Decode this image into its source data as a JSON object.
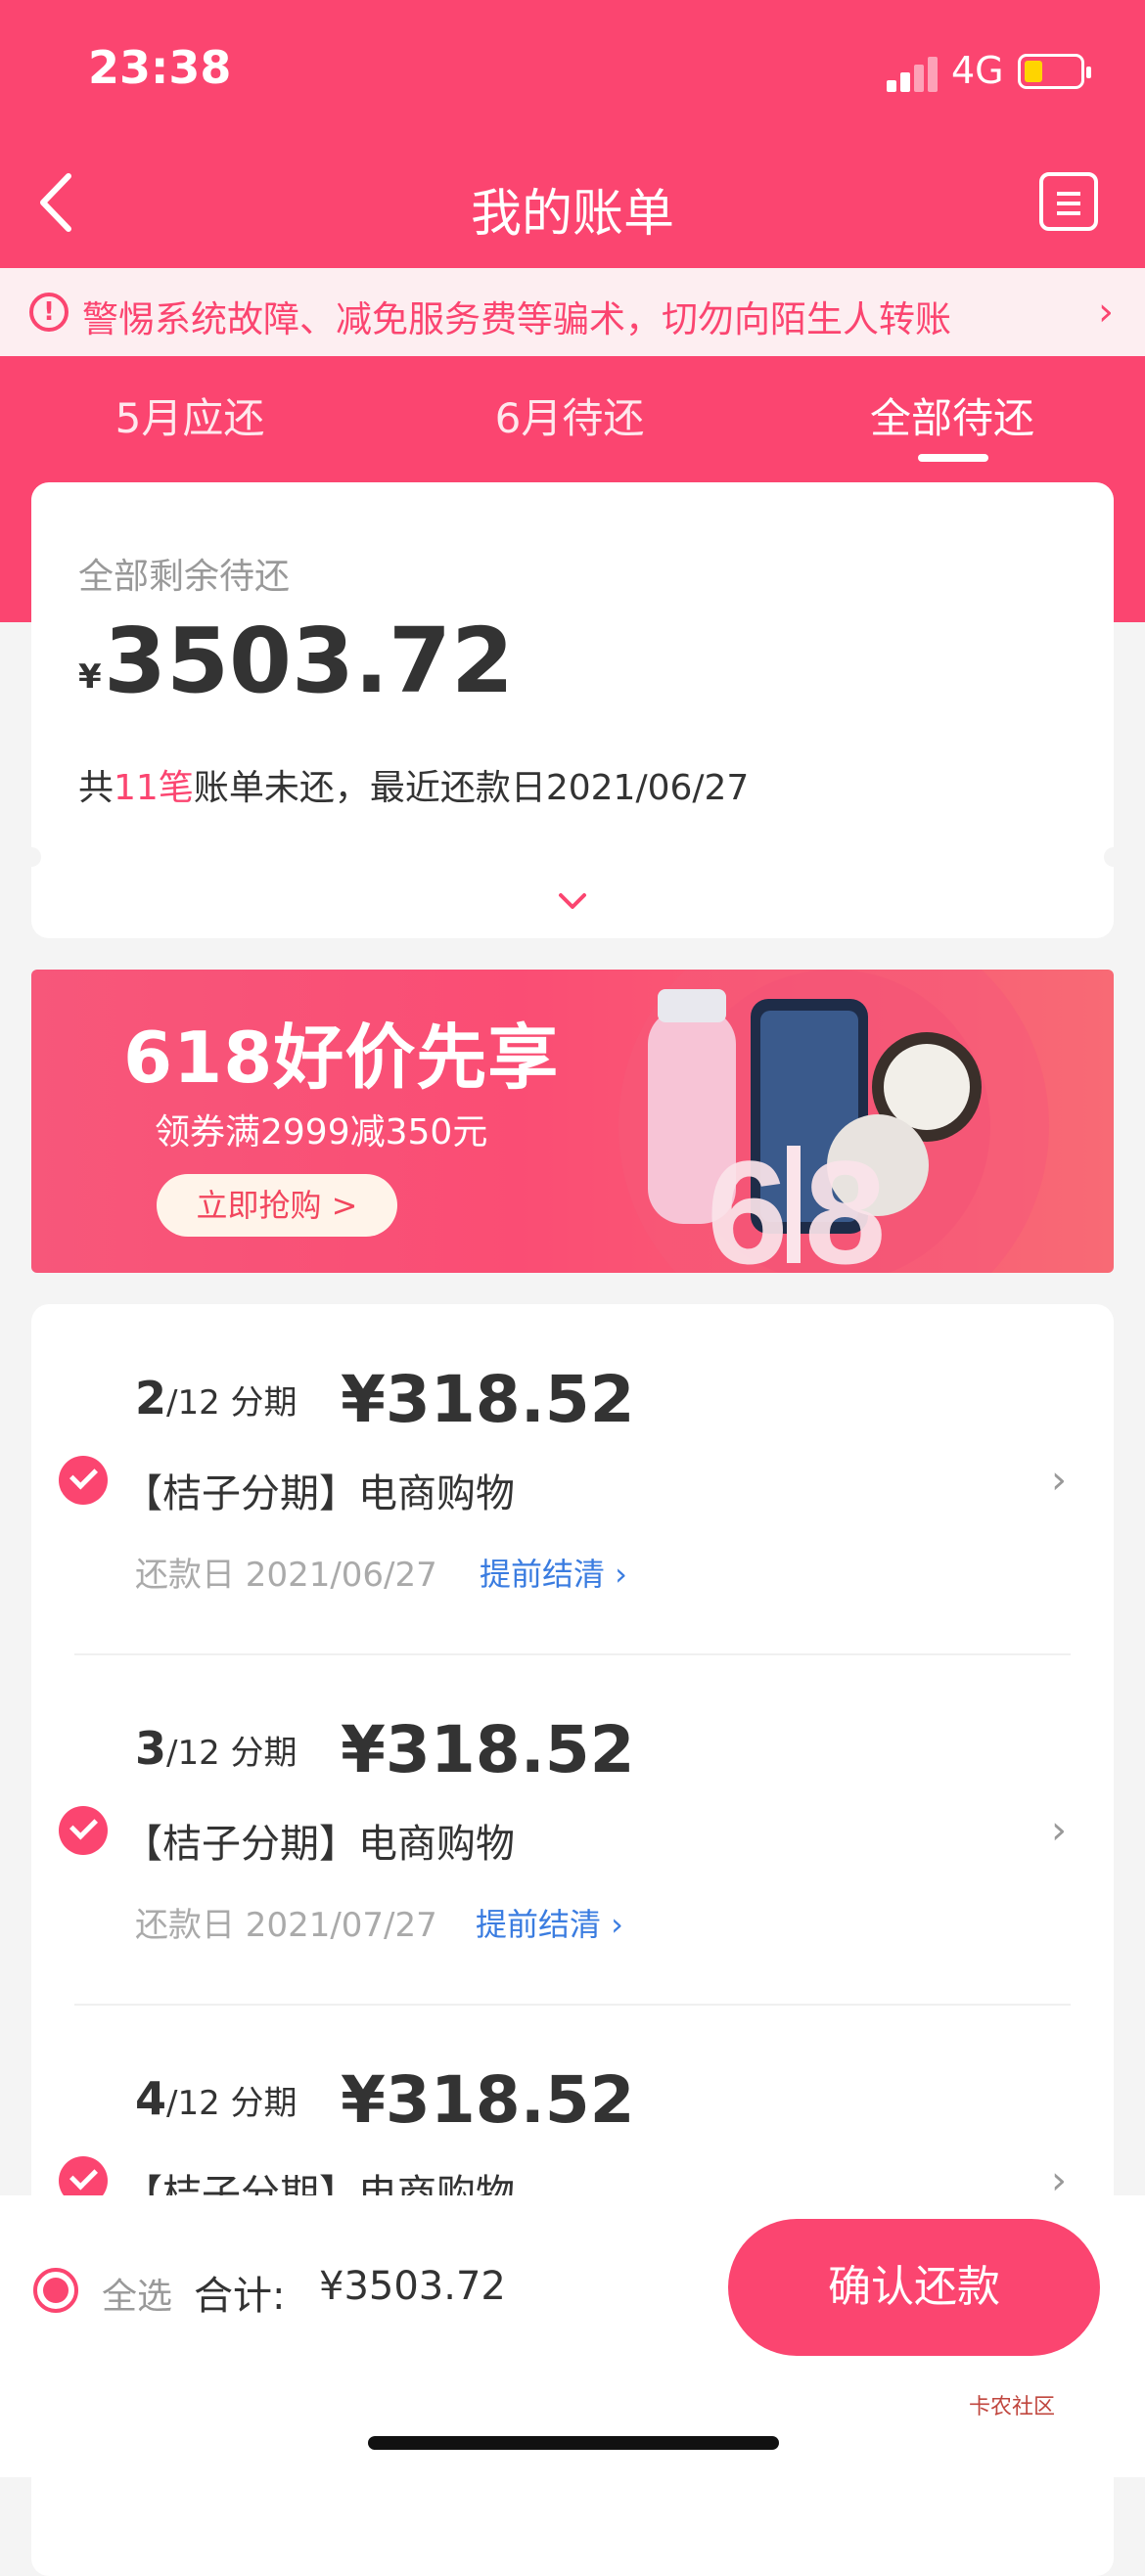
{
  "status_bar": {
    "time": "23:38",
    "network": "4G"
  },
  "header": {
    "title": "我的账单"
  },
  "notice": {
    "text": "警惕系统故障、减免服务费等骗术，切勿向陌生人转账"
  },
  "tabs": [
    {
      "label": "5月应还",
      "active": false
    },
    {
      "label": "6月待还",
      "active": false
    },
    {
      "label": "全部待还",
      "active": true
    }
  ],
  "summary": {
    "label": "全部剩余待还",
    "currency": "¥",
    "amount": "3503.72",
    "desc_prefix": "共",
    "count": "11笔",
    "desc_suffix": "账单未还，最近还款日2021/06/27"
  },
  "banner": {
    "title": "618好价先享",
    "subtitle": "领券满2999减350元",
    "button": "立即抢购 >"
  },
  "bills": [
    {
      "period": "2",
      "total": "/12 分期",
      "amount": "¥318.52",
      "name": "【桔子分期】电商购物",
      "date": "还款日 2021/06/27",
      "link": "提前结清 ›"
    },
    {
      "period": "3",
      "total": "/12 分期",
      "amount": "¥318.52",
      "name": "【桔子分期】电商购物",
      "date": "还款日 2021/07/27",
      "link": "提前结清 ›"
    },
    {
      "period": "4",
      "total": "/12 分期",
      "amount": "¥318.52",
      "name": "【桔子分期】电商购物"
    }
  ],
  "footer": {
    "select_all": "全选",
    "total_label": "合计:",
    "total_amount": "¥3503.72",
    "confirm": "确认还款"
  },
  "watermark": "卡农社区",
  "colors": {
    "accent": "#fb4570",
    "link": "#3a7ce0"
  }
}
